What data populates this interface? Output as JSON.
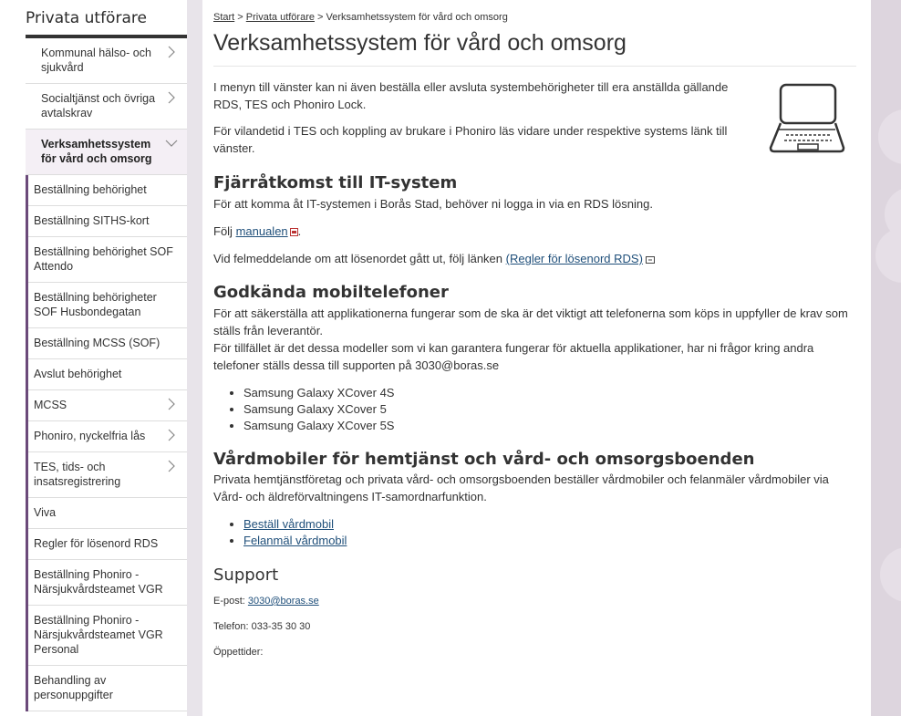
{
  "sidebar": {
    "title": "Privata utförare",
    "items": [
      {
        "label": "Kommunal hälso- och sjukvård",
        "has_children": true
      },
      {
        "label": "Socialtjänst och övriga avtalskrav",
        "has_children": true
      },
      {
        "label": "Verksamhetssystem för vård och omsorg",
        "has_children": true,
        "active": true
      }
    ],
    "subitems": [
      {
        "label": "Beställning behörighet"
      },
      {
        "label": "Beställning SITHS-kort"
      },
      {
        "label": "Beställning behörighet SOF Attendo"
      },
      {
        "label": "Beställning behörigheter SOF Husbondegatan"
      },
      {
        "label": "Beställning MCSS (SOF)"
      },
      {
        "label": "Avslut behörighet"
      },
      {
        "label": "MCSS",
        "has_children": true
      },
      {
        "label": "Phoniro, nyckelfria lås",
        "has_children": true
      },
      {
        "label": "TES, tids- och insatsregistrering",
        "has_children": true
      },
      {
        "label": "Viva"
      },
      {
        "label": "Regler för lösenord RDS"
      },
      {
        "label": "Beställning Phoniro - Närsjukvårdsteamet VGR"
      },
      {
        "label": "Beställning Phoniro - Närsjukvårdsteamet VGR Personal"
      },
      {
        "label": "Behandling av personuppgifter"
      }
    ]
  },
  "breadcrumb": {
    "start": "Start",
    "sep1": " > ",
    "parent": "Privata utförare",
    "sep2": " > ",
    "current": "Verksamhetssystem för vård och omsorg"
  },
  "page": {
    "title": "Verksamhetssystem för vård och omsorg",
    "intro1": "I menyn till vänster kan ni även beställa eller avsluta systembehörigheter till era anställda gällande RDS, TES och Phoniro Lock.",
    "intro2": "För vilandetid i TES och koppling av brukare i Phoniro läs vidare under respektive systems länk till vänster.",
    "remote": {
      "heading": "Fjärråtkomst till IT-system",
      "p1": "För att komma åt IT-systemen i Borås Stad, behöver ni logga in via en RDS lösning.",
      "p2_prefix": "Följ ",
      "p2_link": "manualen",
      "p2_suffix": ".",
      "p3_prefix": "Vid felmeddelande om att lösenordet gått ut, följ länken ",
      "p3_link": "(Regler för lösenord RDS)"
    },
    "phones": {
      "heading": "Godkända mobiltelefoner",
      "p1": "För att säkerställa att applikationerna fungerar som de ska är det viktigt att telefonerna som köps in uppfyller de krav som ställs från leverantör.",
      "p2": "För tillfället är det dessa modeller som vi kan garantera fungerar för aktuella applikationer, har ni frågor kring andra telefoner ställs dessa till supporten på 3030@boras.se",
      "models": [
        "Samsung Galaxy XCover 4S",
        "Samsung Galaxy XCover 5",
        "Samsung Galaxy XCover 5S"
      ]
    },
    "care_phones": {
      "heading": "Vårdmobiler för hemtjänst och vård- och omsorgsboenden",
      "p1": "Privata hemtjänstföretag och privata vård- och omsorgsboenden beställer vårdmobiler och felanmäler vårdmobiler via Vård- och äldreförvaltningens IT-samordnarfunktion.",
      "links": [
        "Beställ vårdmobil",
        "Felanmäl vårdmobil"
      ]
    },
    "support": {
      "heading": "Support",
      "email_label": "E-post: ",
      "email": "3030@boras.se",
      "phone": "Telefon: 033-35 30 30",
      "hours": "Öppettider:"
    }
  },
  "icons": {
    "laptop": "laptop-icon",
    "chevron": "chevron-right-icon",
    "chevron_down": "chevron-down-icon",
    "pdf": "pdf-icon",
    "external": "external-link-icon"
  },
  "colors": {
    "accent": "#6b4a7a",
    "active_bg": "#f4eff5",
    "link": "#1f4f7a",
    "stripe": "#e8e4ea",
    "right_panel": "#ddd5de"
  }
}
